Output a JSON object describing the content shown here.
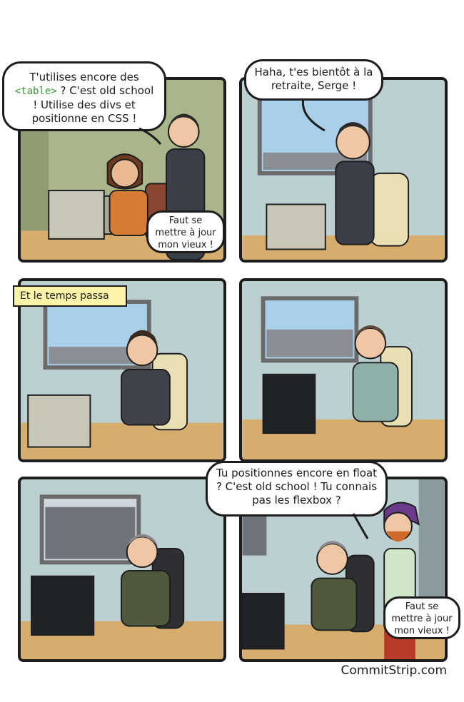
{
  "comic": {
    "panels": [
      {
        "id": 1,
        "bubbles": [
          {
            "text_before": "T'utilises encore des",
            "code": "<table>",
            "text_after": "? C'est old school ! Utilise des divs et positionne en CSS !"
          },
          {
            "text": "Faut se mettre à jour mon vieux !"
          }
        ]
      },
      {
        "id": 2,
        "bubbles": [
          {
            "text": "Haha, t'es bientôt à la retraite, Serge !"
          }
        ]
      },
      {
        "id": 3,
        "caption": "Et le temps passa"
      },
      {
        "id": 4
      },
      {
        "id": 5
      },
      {
        "id": 6,
        "bubbles": [
          {
            "text": "Tu positionnes encore en float ? C'est old school ! Tu connais pas les flexbox ?"
          },
          {
            "text": "Faut se mettre à jour mon vieux !"
          }
        ]
      }
    ]
  },
  "watermark": "CommitStrip.com",
  "colors": {
    "wall": "#bcd0d2",
    "desk": "#e2b97a",
    "outline": "#1d1d1d",
    "caption_bg": "#fbf3a8",
    "code_green": "#3a9a3a"
  }
}
